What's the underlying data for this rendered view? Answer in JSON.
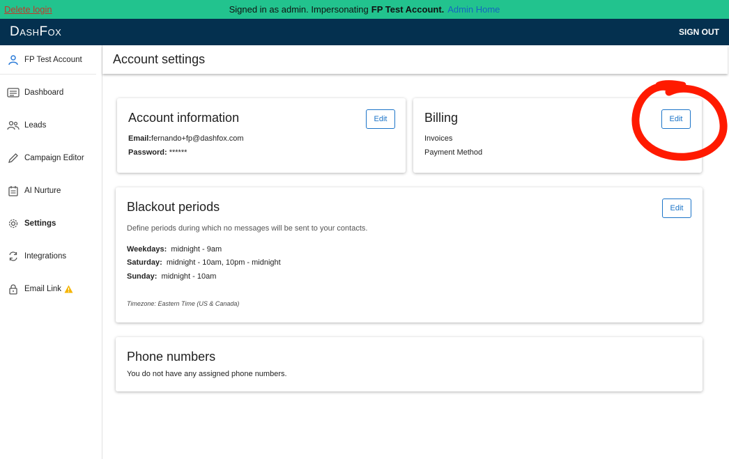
{
  "impersonation": {
    "delete_login": "Delete login",
    "prefix": "Signed in as admin. Impersonating",
    "account": "FP Test Account.",
    "admin_home": "Admin Home"
  },
  "navbar": {
    "brand": "DashFox",
    "sign_out": "SIGN OUT"
  },
  "sidebar": {
    "account": "FP Test Account",
    "items": [
      {
        "label": "Dashboard",
        "icon": "dashboard-icon"
      },
      {
        "label": "Leads",
        "icon": "people-icon"
      },
      {
        "label": "Campaign Editor",
        "icon": "pencil-icon"
      },
      {
        "label": "AI Nurture",
        "icon": "calendar-icon"
      },
      {
        "label": "Settings",
        "icon": "gear-icon"
      },
      {
        "label": "Integrations",
        "icon": "sync-icon"
      },
      {
        "label": "Email Link",
        "icon": "lock-icon"
      }
    ]
  },
  "page": {
    "title": "Account settings"
  },
  "account_info": {
    "title": "Account information",
    "edit": "Edit",
    "email_label": "Email:",
    "email_value": "fernando+fp@dashfox.com",
    "password_label": "Password:",
    "password_value": "******"
  },
  "billing": {
    "title": "Billing",
    "edit": "Edit",
    "invoices": "Invoices",
    "payment_method": "Payment Method"
  },
  "blackout": {
    "title": "Blackout periods",
    "edit": "Edit",
    "description": "Define periods during which no messages will be sent to your contacts.",
    "weekdays_label": "Weekdays:",
    "weekdays_value": "midnight - 9am",
    "saturday_label": "Saturday:",
    "saturday_value": "midnight - 10am, 10pm - midnight",
    "sunday_label": "Sunday:",
    "sunday_value": "midnight - 10am",
    "timezone": "Timezone: Eastern Time (US & Canada)"
  },
  "phone": {
    "title": "Phone numbers",
    "description": "You do not have any assigned phone numbers."
  },
  "colors": {
    "impersonation_bar": "#22c38e",
    "navbar": "#04304f",
    "accent": "#1a73c8",
    "annotation": "#ff1a00"
  }
}
